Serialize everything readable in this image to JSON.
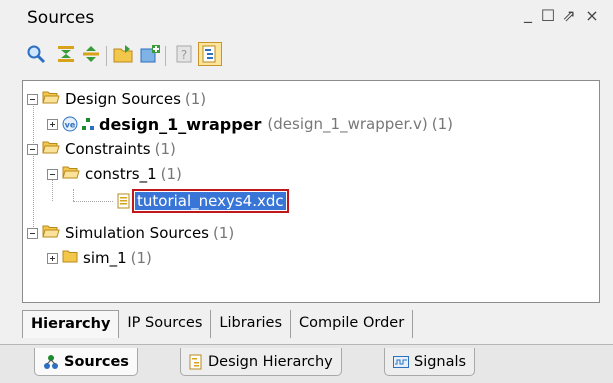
{
  "window": {
    "title": "Sources",
    "controls": {
      "minimize": "_",
      "maximize": "☐",
      "float": "⇗",
      "close": "×"
    }
  },
  "toolbar": {
    "buttons": [
      "search-icon",
      "collapse-all-icon",
      "expand-all-icon",
      "add-sources-icon",
      "add-files-icon",
      "properties-icon",
      "show-hierarchy-icon"
    ]
  },
  "tree": {
    "design_sources": {
      "label": "Design Sources",
      "count": "(1)"
    },
    "design_wrapper": {
      "label": "design_1_wrapper",
      "file": "(design_1_wrapper.v)",
      "count": "(1)",
      "badge": "ve"
    },
    "constraints": {
      "label": "Constraints",
      "count": "(1)"
    },
    "constrs": {
      "label": "constrs_1",
      "count": "(1)"
    },
    "xdc_file": {
      "label": "tutorial_nexys4.xdc"
    },
    "simulation_sources": {
      "label": "Simulation Sources",
      "count": "(1)"
    },
    "sim": {
      "label": "sim_1",
      "count": "(1)"
    }
  },
  "view_tabs": [
    "Hierarchy",
    "IP Sources",
    "Libraries",
    "Compile Order"
  ],
  "bottom_tabs": [
    "Sources",
    "Design Hierarchy",
    "Signals"
  ],
  "colors": {
    "selection": "#3875d7",
    "highlight_border": "#c0171d",
    "folder": "#f3c74a"
  }
}
